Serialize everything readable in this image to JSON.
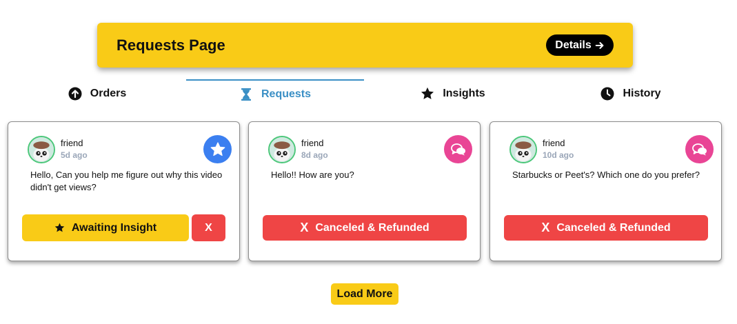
{
  "header": {
    "title": "Requests Page",
    "details_label": "Details"
  },
  "tabs": [
    {
      "label": "Orders",
      "icon": "arrow-up-circle-icon",
      "active": false
    },
    {
      "label": "Requests",
      "icon": "hourglass-icon",
      "active": true
    },
    {
      "label": "Insights",
      "icon": "star-icon",
      "active": false
    },
    {
      "label": "History",
      "icon": "clock-icon",
      "active": false
    }
  ],
  "cards": [
    {
      "user": "friend",
      "time": "5d ago",
      "badge_icon": "star-badge-icon",
      "message": "Hello, Can you help me figure out why this video didn't get views?",
      "primary_label": "Awaiting Insight",
      "secondary_label": "X"
    },
    {
      "user": "friend",
      "time": "8d ago",
      "badge_icon": "chat-bubbles-icon",
      "message": "Hello!! How are you?",
      "x_mark": "X",
      "primary_label": "Canceled & Refunded"
    },
    {
      "user": "friend",
      "time": "10d ago",
      "badge_icon": "chat-bubbles-icon",
      "message": "Starbucks or Peet's? Which one do you prefer?",
      "x_mark": "X",
      "primary_label": "Canceled & Refunded"
    }
  ],
  "load_more_label": "Load More",
  "colors": {
    "brand_yellow": "#f9cb17",
    "active_tab": "#3a8fc5",
    "cancel_red": "#ef4545",
    "badge_blue": "#3b7ff0",
    "badge_pink": "#e94595"
  }
}
